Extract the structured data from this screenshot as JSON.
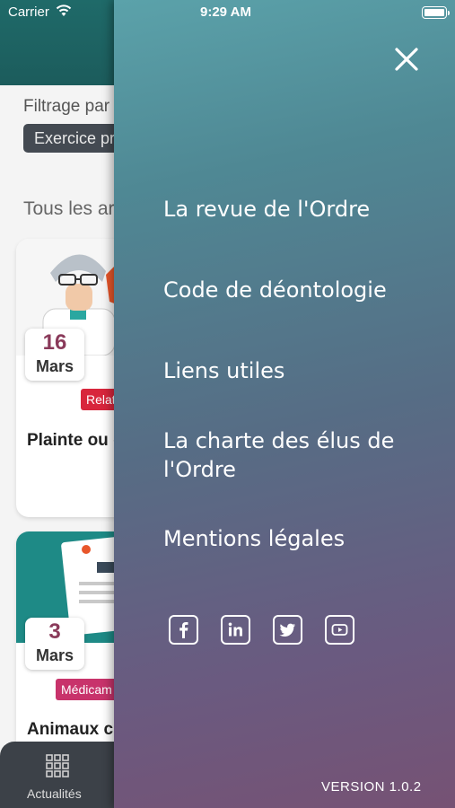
{
  "status_bar": {
    "carrier": "Carrier",
    "time": "9:29 AM"
  },
  "background": {
    "filter_label": "Filtrage par",
    "filter_chip": "Exercice pr",
    "section_title": "Tous les ar",
    "cards": [
      {
        "day": "16",
        "month": "Mars",
        "category": "Relat",
        "title": "Plainte ou courante : répondre"
      },
      {
        "day": "3",
        "month": "Mars",
        "category": "Médicam",
        "title": "Animaux c"
      }
    ],
    "tab_label": "Actualités"
  },
  "drawer": {
    "menu": [
      "La revue de l'Ordre",
      "Code de déontologie",
      "Liens utiles",
      "La charte des élus de l'Ordre",
      "Mentions légales"
    ],
    "socials": [
      "facebook-icon",
      "linkedin-icon",
      "twitter-icon",
      "youtube-icon"
    ],
    "version": "VERSION 1.0.2"
  },
  "colors": {
    "drawer_top": "#5ba2aa",
    "drawer_bottom": "#765274",
    "header_teal": "#1f6a69",
    "tab_bar": "#3c4148",
    "date_accent": "#8a3a5a",
    "tag_red": "#d8263c"
  }
}
